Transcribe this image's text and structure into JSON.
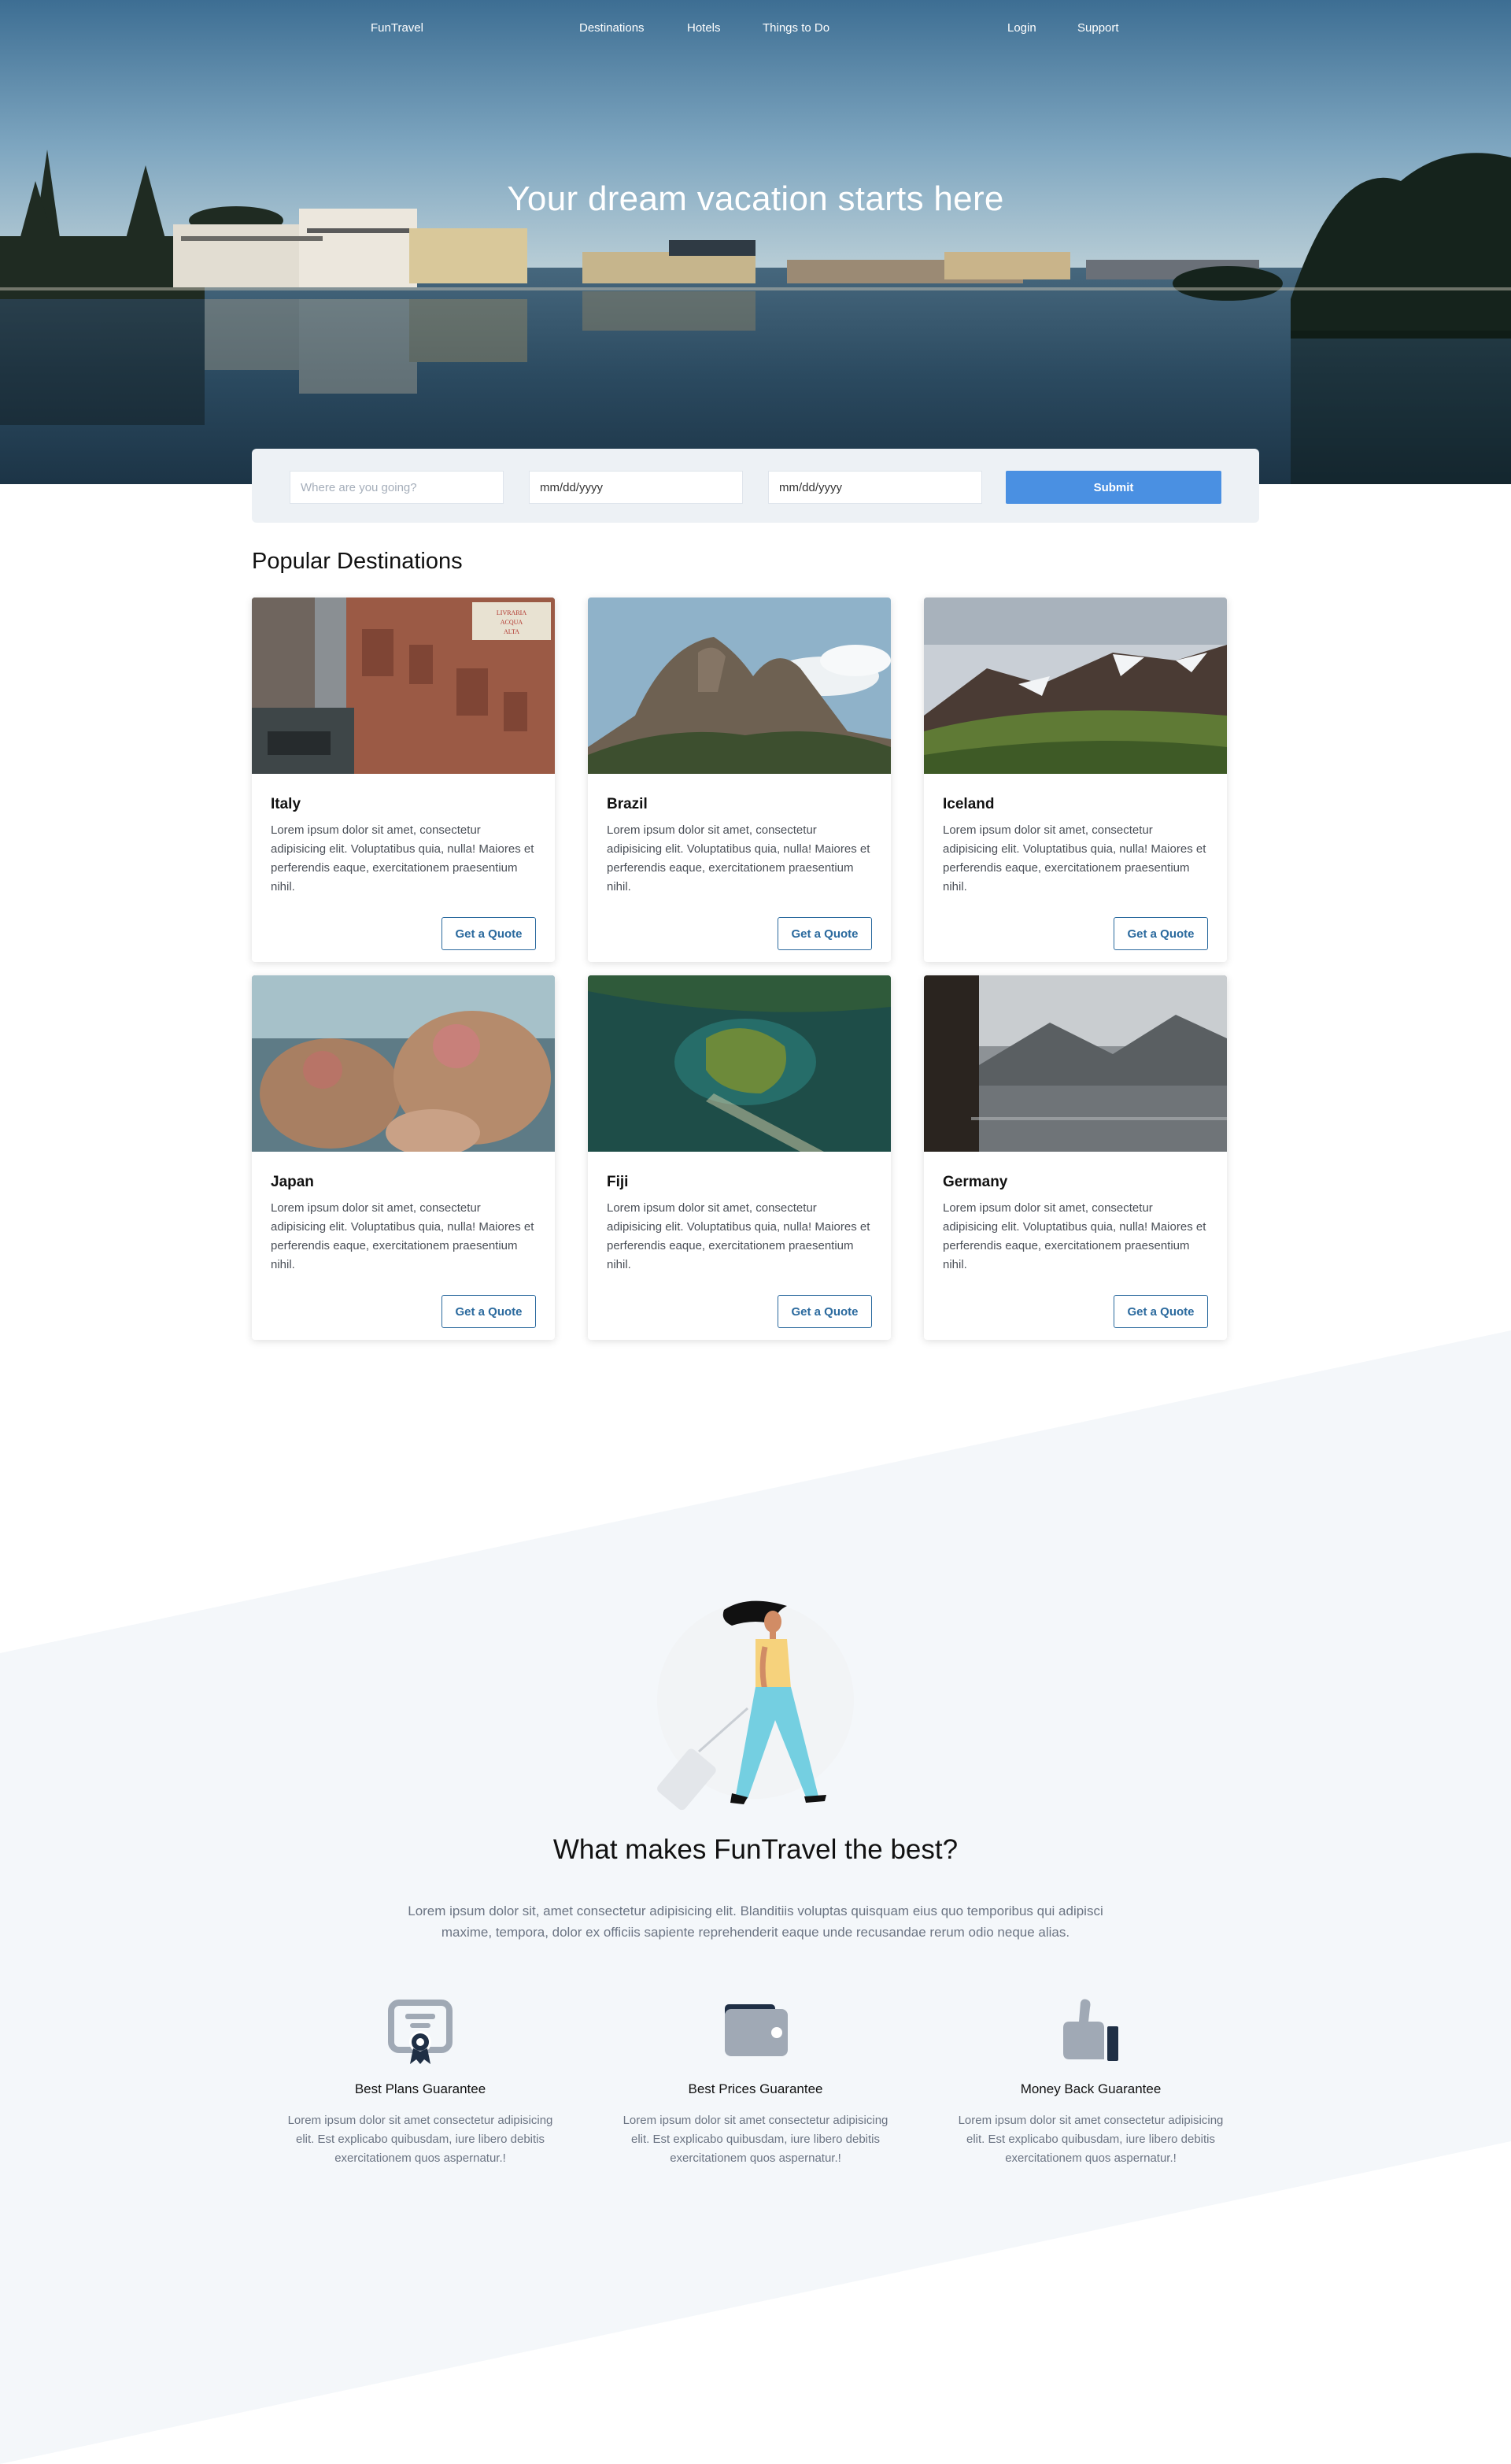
{
  "nav": {
    "brand": "FunTravel",
    "links": [
      "Destinations",
      "Hotels",
      "Things to Do"
    ],
    "login": "Login",
    "support": "Support"
  },
  "hero": {
    "title": "Your dream vacation starts here"
  },
  "search": {
    "destination_placeholder": "Where are you going?",
    "checkin_value": "mm/dd/yyyy",
    "checkout_value": "mm/dd/yyyy",
    "submit_label": "Submit"
  },
  "destinations": {
    "title": "Popular Destinations",
    "cards": [
      {
        "name": "Italy",
        "text": "Lorem ipsum dolor sit amet, consectetur adipisicing elit. Voluptatibus quia, nulla! Maiores et perferendis eaque, exercitationem praesentium nihil.",
        "button": "Get a Quote",
        "sign": "LIVRARIA\nACQUA\nALTA"
      },
      {
        "name": "Brazil",
        "text": "Lorem ipsum dolor sit amet, consectetur adipisicing elit. Voluptatibus quia, nulla! Maiores et perferendis eaque, exercitationem praesentium nihil.",
        "button": "Get a Quote"
      },
      {
        "name": "Iceland",
        "text": "Lorem ipsum dolor sit amet, consectetur adipisicing elit. Voluptatibus quia, nulla! Maiores et perferendis eaque, exercitationem praesentium nihil.",
        "button": "Get a Quote"
      },
      {
        "name": "Japan",
        "text": "Lorem ipsum dolor sit amet, consectetur adipisicing elit. Voluptatibus quia, nulla! Maiores et perferendis eaque, exercitationem praesentium nihil.",
        "button": "Get a Quote"
      },
      {
        "name": "Fiji",
        "text": "Lorem ipsum dolor sit amet, consectetur adipisicing elit. Voluptatibus quia, nulla! Maiores et perferendis eaque, exercitationem praesentium nihil.",
        "button": "Get a Quote"
      },
      {
        "name": "Germany",
        "text": "Lorem ipsum dolor sit amet, consectetur adipisicing elit. Voluptatibus quia, nulla! Maiores et perferendis eaque, exercitationem praesentium nihil.",
        "button": "Get a Quote"
      }
    ]
  },
  "why": {
    "title": "What makes FunTravel the best?",
    "text": "Lorem ipsum dolor sit, amet consectetur adipisicing elit. Blanditiis voluptas quisquam eius quo temporibus qui adipisci maxime, tempora, dolor ex officiis sapiente reprehenderit eaque unde recusandae rerum odio neque alias.",
    "features": [
      {
        "icon": "certificate-icon",
        "title": "Best Plans Guarantee",
        "text": "Lorem ipsum dolor sit amet consectetur adipisicing elit. Est explicabo quibusdam, iure libero debitis exercitationem quos aspernatur.!"
      },
      {
        "icon": "wallet-icon",
        "title": "Best Prices Guarantee",
        "text": "Lorem ipsum dolor sit amet consectetur adipisicing elit. Est explicabo quibusdam, iure libero debitis exercitationem quos aspernatur.!"
      },
      {
        "icon": "thumbs-up-icon",
        "title": "Money Back Guarantee",
        "text": "Lorem ipsum dolor sit amet consectetur adipisicing elit. Est explicabo quibusdam, iure libero debitis exercitationem quos aspernatur.!"
      }
    ]
  },
  "colors": {
    "accent": "#4a90e2",
    "quote_button": "#2b6a9e",
    "band": "#f4f7fa",
    "icon_gray": "#a0a9b5",
    "icon_dark": "#1f2f45"
  }
}
